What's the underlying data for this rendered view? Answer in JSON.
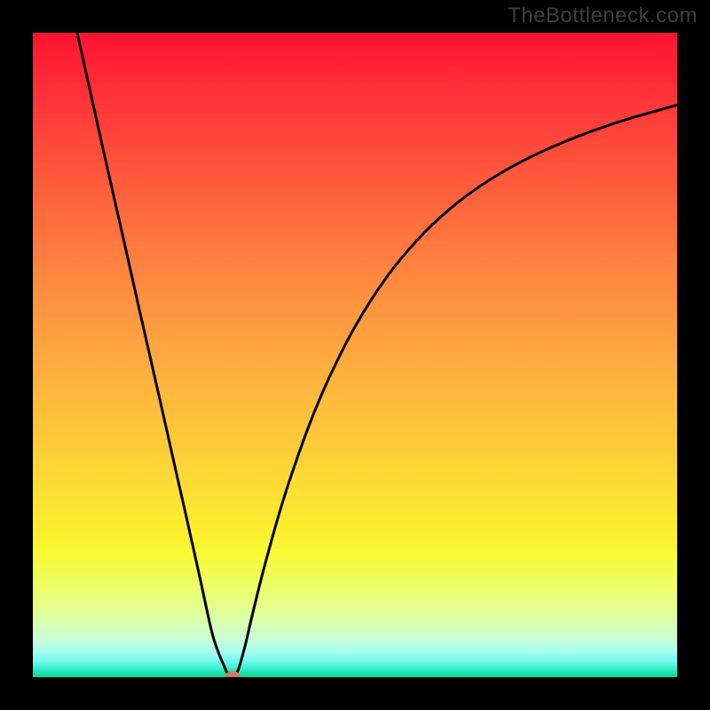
{
  "watermark": "TheBottleneck.com",
  "chart_data": {
    "type": "line",
    "title": "",
    "xlabel": "",
    "ylabel": "",
    "xlim": [
      0,
      100
    ],
    "ylim": [
      0,
      100
    ],
    "grid": false,
    "series": [
      {
        "name": "bottleneck-curve",
        "x": [
          6.89,
          8,
          10,
          12,
          14,
          16,
          18,
          20,
          22,
          24,
          26,
          28,
          30,
          30.5,
          30.99,
          31.5,
          32,
          33,
          34,
          35,
          36,
          38,
          40,
          43,
          46,
          50,
          55,
          60,
          65,
          70,
          76,
          83,
          91,
          100
        ],
        "values": [
          100,
          95.0,
          86.0,
          77.1,
          68.3,
          59.4,
          50.6,
          41.8,
          32.9,
          24.1,
          15.1,
          6.2,
          1.0,
          0.4,
          0.12,
          0.5,
          1.5,
          5.1,
          9.4,
          13.5,
          17.4,
          24.6,
          31.0,
          39.4,
          46.5,
          54.4,
          62.2,
          68.2,
          72.9,
          76.6,
          80.1,
          83.3,
          86.2,
          88.8
        ]
      }
    ],
    "marker": {
      "x": 30.99,
      "y": 0.12,
      "color": "#cd7b6e"
    },
    "gradient_stops": [
      {
        "pos": 0,
        "color": "#fe1430"
      },
      {
        "pos": 0.52,
        "color": "#feae3f"
      },
      {
        "pos": 0.81,
        "color": "#f7fa34"
      },
      {
        "pos": 1.0,
        "color": "#04d989"
      }
    ]
  },
  "plot_geometry": {
    "inner_w": 726,
    "inner_h": 726
  }
}
